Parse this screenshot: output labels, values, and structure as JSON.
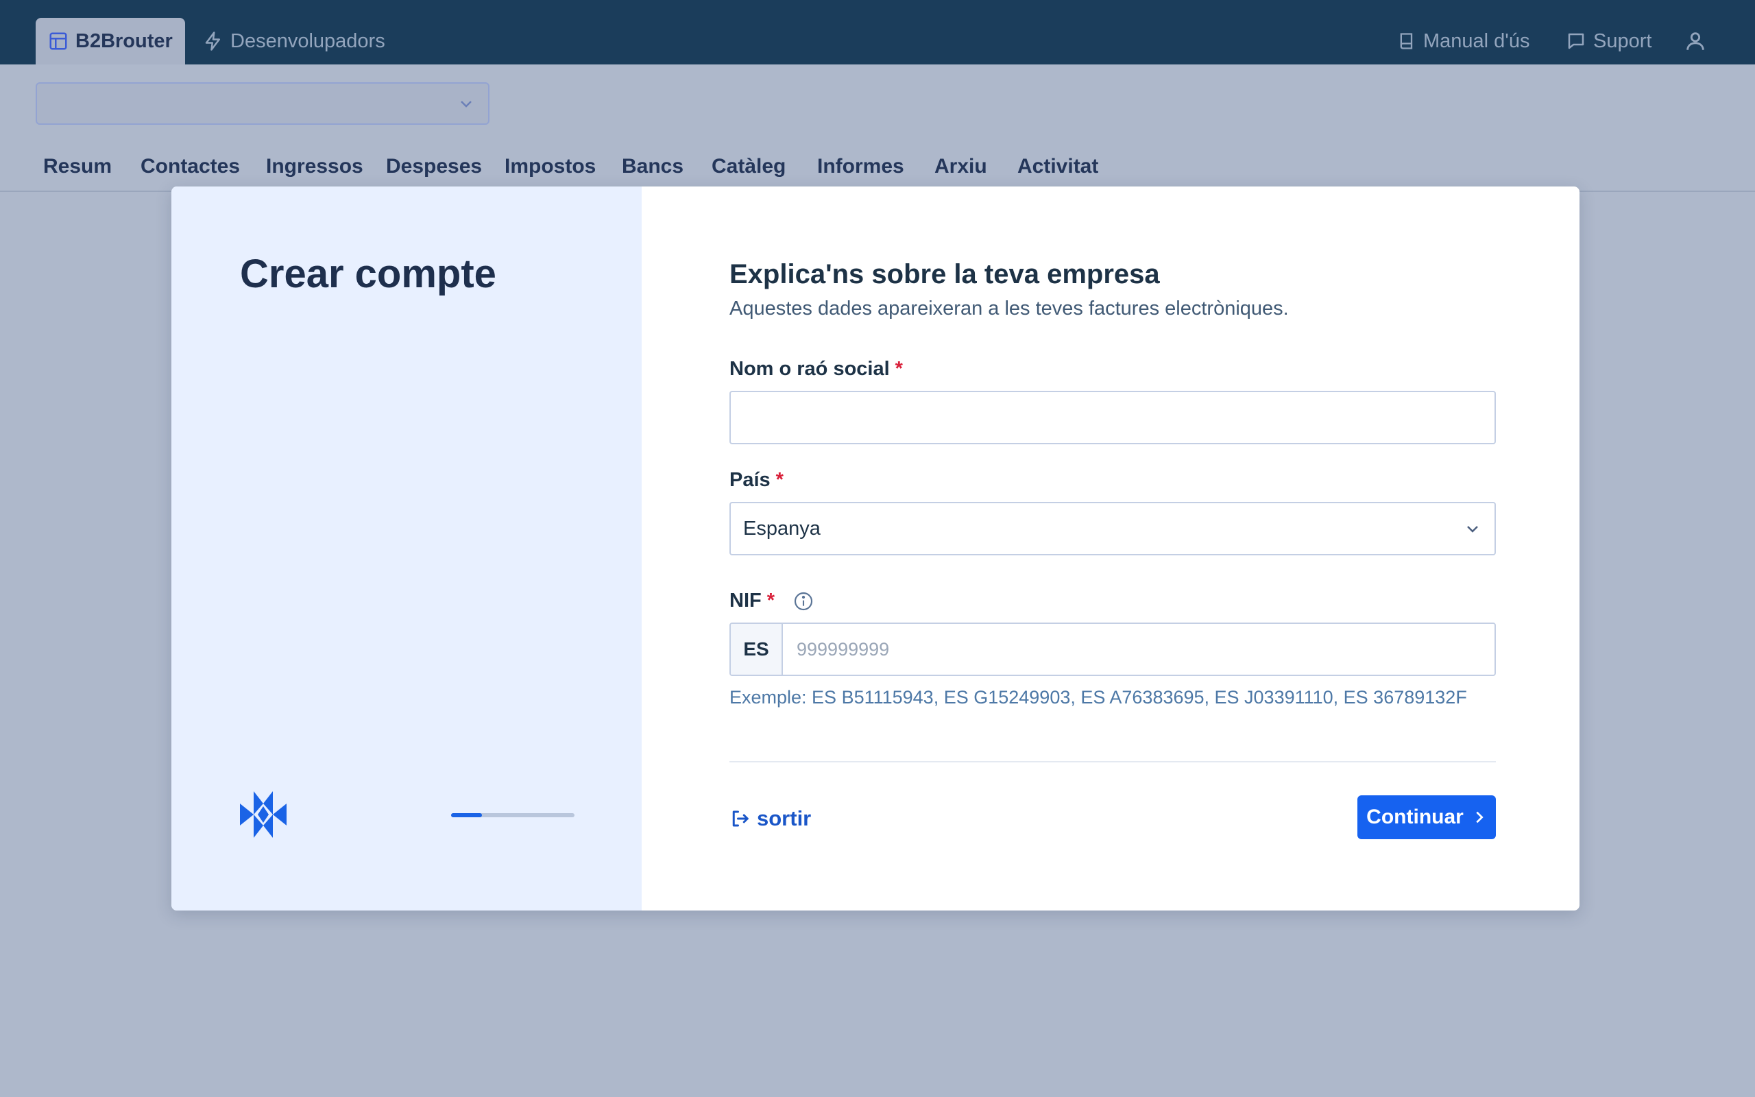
{
  "topbar": {
    "tabs": [
      {
        "label": "B2Brouter",
        "icon": "layout-icon",
        "active": true
      },
      {
        "label": "Desenvolupadors",
        "icon": "lightning-icon",
        "active": false
      }
    ],
    "links": [
      {
        "label": "Manual d'ús",
        "icon": "book-icon"
      },
      {
        "label": "Suport",
        "icon": "chat-icon"
      }
    ],
    "user_icon": "user-icon"
  },
  "company_select": {
    "value": ""
  },
  "nav": {
    "items": [
      "Resum",
      "Contactes",
      "Ingressos",
      "Despeses",
      "Impostos",
      "Bancs",
      "Catàleg",
      "Informes",
      "Arxiu",
      "Activitat"
    ]
  },
  "modal": {
    "title": "Crear compte",
    "progress": 0.25,
    "form": {
      "title": "Explica'ns sobre la teva empresa",
      "subtitle": "Aquestes dades apareixeran a les teves factures electròniques.",
      "name_label": "Nom o raó social",
      "name_value": "",
      "country_label": "País",
      "country_value": "Espanya",
      "nif_label": "NIF",
      "nif_prefix": "ES",
      "nif_placeholder": "999999999",
      "nif_help": "Exemple: ES B51115943, ES G15249903, ES A76383695, ES J03391110, ES 36789132F",
      "required_mark": "*",
      "exit_label": "sortir",
      "continue_label": "Continuar"
    }
  },
  "colors": {
    "topbar": "#1b3d5b",
    "overlay": "#aeb8cb",
    "accent": "#1662f0",
    "required": "#d9213b"
  }
}
